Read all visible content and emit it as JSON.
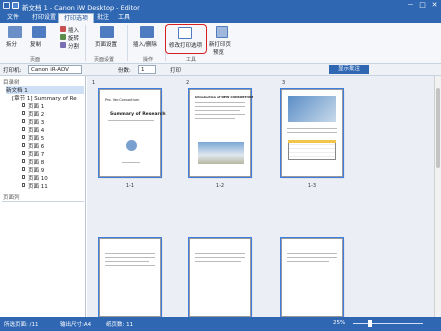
{
  "title": "新文档 1 - Canon iW Desktop - Editor",
  "window_buttons": [
    "－",
    "□",
    "✕"
  ],
  "menu": {
    "file": "文件",
    "tabs": [
      "打印设置",
      "打印选项",
      "批注",
      "工具"
    ]
  },
  "ribbon": {
    "page_label": "操作",
    "btns": [
      "拆分",
      "复制",
      "插入",
      "旋转",
      "分割",
      "页面设置",
      "插入/删除",
      "修改打印选项",
      "新打印页",
      "预览"
    ],
    "groups": [
      "页面",
      "页面设置",
      "操作",
      "工具"
    ]
  },
  "toolbar": {
    "printer_label": "打印机:",
    "printer_value": "Canon iR-ADV",
    "copies_label": "份数:",
    "copies_value": "1",
    "print_button": "打印",
    "preview_button": "显示批注"
  },
  "tree": {
    "header": "目录树",
    "root": "新文档 1",
    "book": "[章节 1] Summary of Re",
    "pages": [
      "页面 1",
      "页面 2",
      "页面 3",
      "页面 4",
      "页面 5",
      "页面 6",
      "页面 7",
      "页面 8",
      "页面 9",
      "页面 10",
      "页面 11"
    ],
    "page_panel": "页面列"
  },
  "thumbs": {
    "numbers": [
      "1",
      "2",
      "3"
    ],
    "labels": [
      "1-1",
      "1-2",
      "1-3"
    ],
    "t1_title": "Summary of Research",
    "t1_header": "Pro. Ver.Consortium",
    "t2_header": "Introduction of NEW CONSORTIUM"
  },
  "status": {
    "left1": "所选页面: /11",
    "left2": "输出尺寸:A4",
    "left3": "纸页数: 11",
    "zoom": "25%"
  },
  "colors": {
    "accent": "#2f67b3",
    "highlight": "#d82020"
  }
}
